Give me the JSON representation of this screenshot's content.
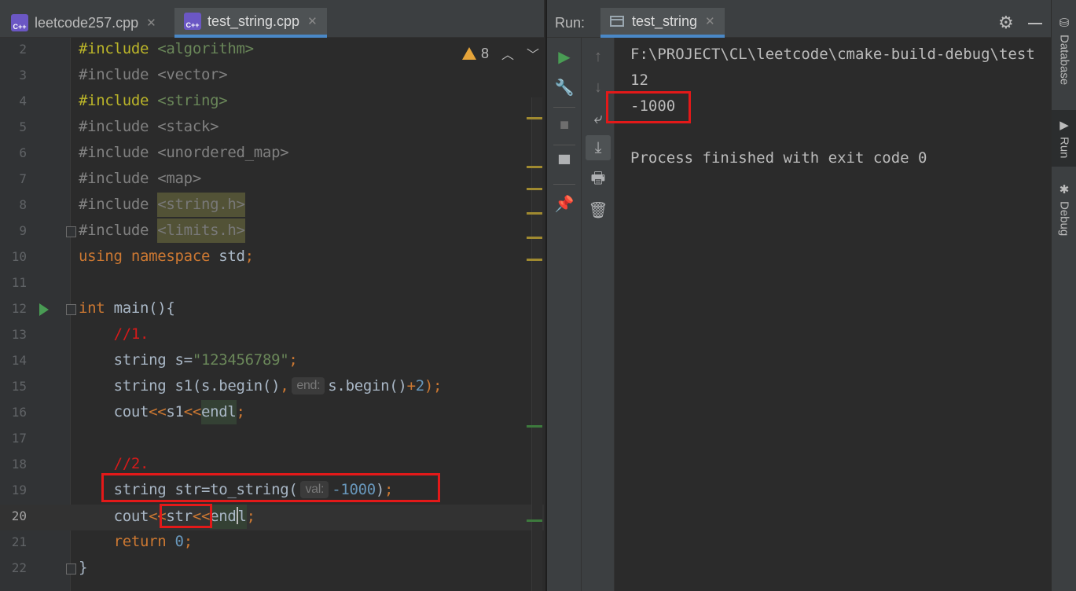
{
  "editor": {
    "tabs": [
      {
        "label": "leetcode257.cpp",
        "badge": "C++",
        "active": false
      },
      {
        "label": "test_string.cpp",
        "badge": "C++",
        "active": true
      }
    ],
    "warning_count": "8",
    "hints": {
      "end": "end:",
      "val": "val:"
    },
    "line_numbers": [
      "2",
      "3",
      "4",
      "5",
      "6",
      "7",
      "8",
      "9",
      "10",
      "11",
      "12",
      "13",
      "14",
      "15",
      "16",
      "17",
      "18",
      "19",
      "20",
      "21",
      "22"
    ],
    "lines": {
      "l2": {
        "kw": "#include",
        "arg": "<algorithm>"
      },
      "l3": {
        "kw": "#include",
        "arg": "<vector>"
      },
      "l4": {
        "kw": "#include",
        "arg": "<string>"
      },
      "l5": {
        "kw": "#include",
        "arg": "<stack>"
      },
      "l6": {
        "kw": "#include",
        "arg": "<unordered_map>"
      },
      "l7": {
        "kw": "#include",
        "arg": "<map>"
      },
      "l8": {
        "kw": "#include",
        "arg": "<string.h>"
      },
      "l9": {
        "kw": "#include",
        "arg": "<limits.h>"
      },
      "l10": {
        "a": "using",
        "b": "namespace",
        "c": "std",
        "d": ";"
      },
      "l12": {
        "a": "int",
        "b": "main(){"
      },
      "l13": {
        "a": "//1."
      },
      "l14": {
        "a": "string s=",
        "b": "\"123456789\"",
        "c": ";"
      },
      "l15": {
        "a": "string s1(s.begin()",
        "b": ",",
        "c": "s.begin()",
        "d": "+",
        "e": "2",
        "f": ");"
      },
      "l16": {
        "a": "cout",
        "b": "<<",
        "c": "s1",
        "d": "<<",
        "e": "endl",
        "f": ";"
      },
      "l18": {
        "a": "//2."
      },
      "l19": {
        "a": "string str=to_string(",
        "b": "-1000",
        "c": ")",
        "d": ";"
      },
      "l20": {
        "a": "cout",
        "b": "<",
        "c": "<",
        "d": "str",
        "e": "<",
        "f": "<",
        "g": "end",
        "h": "l",
        "i": ";"
      },
      "l21": {
        "a": "return",
        "b": "0",
        "c": ";"
      },
      "l22": {
        "a": "}"
      }
    }
  },
  "run": {
    "label": "Run:",
    "tab_label": "test_string",
    "output": [
      "F:\\PROJECT\\CL\\leetcode\\cmake-build-debug\\test",
      "12",
      "-1000",
      "",
      "Process finished with exit code 0"
    ]
  },
  "right_stripe": {
    "database": "Database",
    "run": "Run",
    "debug": "Debug"
  },
  "colors": {
    "accent": "#4a88c7",
    "highlight_box": "#e31919",
    "run_green": "#499c54",
    "warning": "#e5a43a"
  }
}
